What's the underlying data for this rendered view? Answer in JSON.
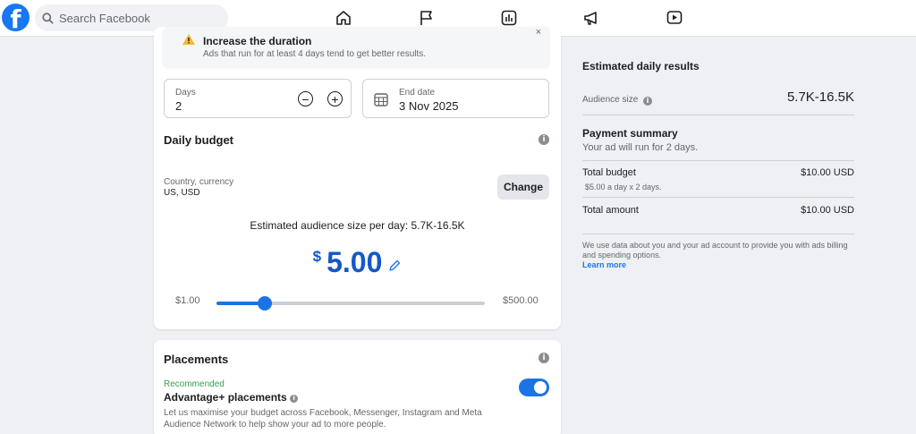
{
  "nav": {
    "search_placeholder": "Search Facebook",
    "icons": [
      "home-icon",
      "flag-icon",
      "insights-icon",
      "megaphone-icon",
      "video-icon"
    ]
  },
  "notice": {
    "title": "Increase the duration",
    "text": "Ads that run for at least 4 days tend to get better results."
  },
  "duration": {
    "days_label": "Days",
    "days_value": "2",
    "end_label": "End date",
    "end_value": "3 Nov 2025"
  },
  "budget": {
    "title": "Daily budget",
    "country_label": "Country, currency",
    "country_value": "US, USD",
    "change_label": "Change",
    "estimate_text": "Estimated audience size per day: 5.7K-16.5K",
    "currency_symbol": "$",
    "amount": "5.00",
    "slider_min": "$1.00",
    "slider_max": "$500.00",
    "slider_fraction": 0.18
  },
  "placements": {
    "title": "Placements",
    "recommended": "Recommended",
    "option": "Advantage+ placements",
    "desc": "Let us maximise your budget across Facebook, Messenger, Instagram and Meta Audience Network to help show your ad to more people.",
    "enabled": true
  },
  "results": {
    "title": "Estimated daily results",
    "audience_label": "Audience size",
    "audience_value": "5.7K-16.5K"
  },
  "payment": {
    "title": "Payment summary",
    "subtitle": "Your ad will run for 2 days.",
    "total_budget_label": "Total budget",
    "total_budget_value": "$10.00 USD",
    "total_budget_sub": "$5.00 a day x 2 days.",
    "total_amount_label": "Total amount",
    "total_amount_value": "$10.00 USD",
    "footnote": "We use data about you and your ad account to provide you with ads billing and spending options.",
    "learn_more": "Learn more"
  },
  "colors": {
    "accent": "#1b74e4",
    "price": "#1457c9",
    "recommended": "#31a24c"
  }
}
